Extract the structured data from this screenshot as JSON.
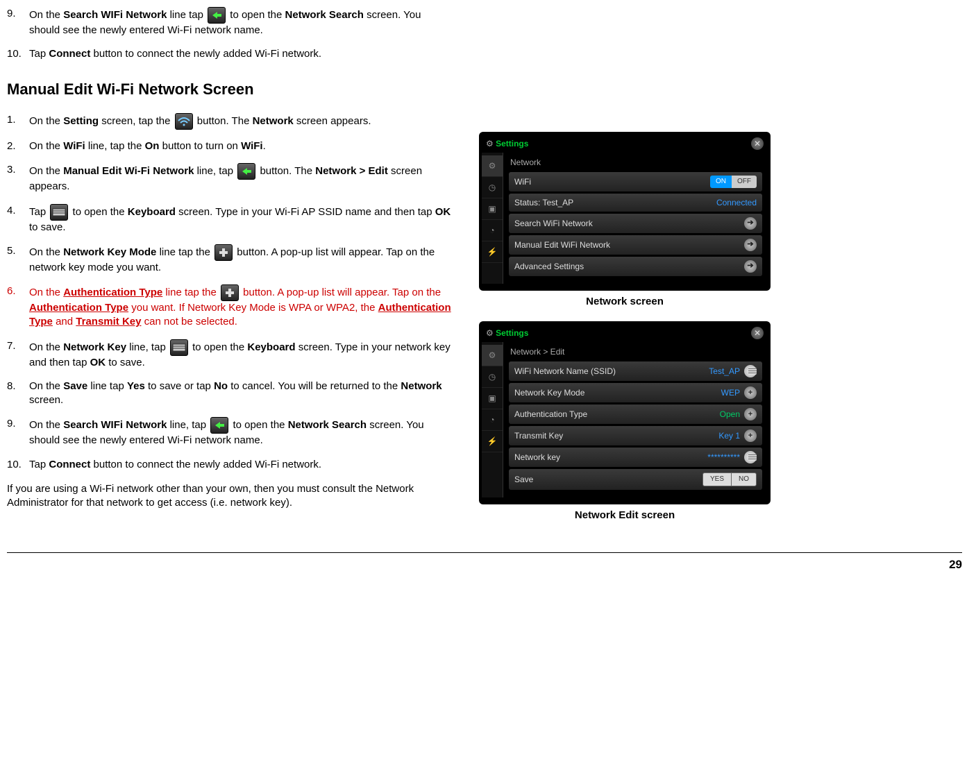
{
  "page_number": "29",
  "top_steps": [
    {
      "num": "9.",
      "parts": [
        {
          "t": "On the "
        },
        {
          "b": "Search WIFi Network"
        },
        {
          "t": " line tap "
        },
        {
          "icon": "arrow"
        },
        {
          "t": " to open the "
        },
        {
          "b": "Network Search"
        },
        {
          "t": " screen.  You should see the newly entered Wi-Fi network name."
        }
      ]
    },
    {
      "num": "10.",
      "parts": [
        {
          "t": "Tap "
        },
        {
          "b": "Connect"
        },
        {
          "t": " button to connect the newly added Wi-Fi network."
        }
      ]
    }
  ],
  "heading": "Manual Edit Wi-Fi Network Screen",
  "main_steps": [
    {
      "num": "1.",
      "parts": [
        {
          "t": "On the "
        },
        {
          "b": "Setting"
        },
        {
          "t": " screen, tap the "
        },
        {
          "icon": "wifi"
        },
        {
          "t": " button.  The "
        },
        {
          "b": "Network"
        },
        {
          "t": " screen appears."
        }
      ]
    },
    {
      "num": "2.",
      "parts": [
        {
          "t": "On the "
        },
        {
          "b": "WiFi"
        },
        {
          "t": " line, tap the "
        },
        {
          "b": "On"
        },
        {
          "t": " button to turn on "
        },
        {
          "b": "WiFi"
        },
        {
          "t": "."
        }
      ]
    },
    {
      "num": "3.",
      "parts": [
        {
          "t": "On the "
        },
        {
          "b": "Manual Edit Wi-Fi Network"
        },
        {
          "t": " line, tap "
        },
        {
          "icon": "arrow"
        },
        {
          "t": " button.  The "
        },
        {
          "b": "Network > Edit"
        },
        {
          "t": " screen appears."
        }
      ]
    },
    {
      "num": "4.",
      "parts": [
        {
          "t": "Tap "
        },
        {
          "icon": "keyboard"
        },
        {
          "t": " to open the "
        },
        {
          "b": "Keyboard"
        },
        {
          "t": " screen.  Type in your Wi-Fi AP SSID name and then tap "
        },
        {
          "b": "OK"
        },
        {
          "t": " to save."
        }
      ]
    },
    {
      "num": "5.",
      "parts": [
        {
          "t": "On the "
        },
        {
          "b": "Network Key Mode"
        },
        {
          "t": " line tap the "
        },
        {
          "icon": "plus"
        },
        {
          "t": " button.  A pop-up list will appear.  Tap on the network key mode you want."
        }
      ]
    },
    {
      "num": "6.",
      "red": true,
      "parts": [
        {
          "t": "On the "
        },
        {
          "bu": "Authentication Type"
        },
        {
          "t": " line tap the "
        },
        {
          "icon": "plus"
        },
        {
          "t": " button.  A pop-up list will appear.  Tap on the "
        },
        {
          "bu": "Authentication Type"
        },
        {
          "t": " you want. If Network Key Mode is WPA or WPA2, the "
        },
        {
          "bu": "Authentication Type"
        },
        {
          "t": " and "
        },
        {
          "bu": "Transmit Key"
        },
        {
          "t": " can not be selected."
        }
      ]
    },
    {
      "num": "7.",
      "parts": [
        {
          "t": "On the "
        },
        {
          "b": "Network Key"
        },
        {
          "t": " line, tap "
        },
        {
          "icon": "keyboard"
        },
        {
          "t": " to open the "
        },
        {
          "b": "Keyboard"
        },
        {
          "t": " screen.  Type in your network key and then tap "
        },
        {
          "b": "OK"
        },
        {
          "t": " to save."
        }
      ]
    },
    {
      "num": "8.",
      "parts": [
        {
          "t": "On the "
        },
        {
          "b": "Save"
        },
        {
          "t": " line tap "
        },
        {
          "b": "Yes"
        },
        {
          "t": " to save or tap "
        },
        {
          "b": "No"
        },
        {
          "t": " to cancel.  You will be returned to the "
        },
        {
          "b": "Network"
        },
        {
          "t": " screen."
        }
      ]
    },
    {
      "num": "9.",
      "parts": [
        {
          "t": "On the "
        },
        {
          "b": "Search WIFi Network"
        },
        {
          "t": " line, tap "
        },
        {
          "icon": "arrow"
        },
        {
          "t": " to open the "
        },
        {
          "b": "Network Search"
        },
        {
          "t": " screen.  You should see the newly entered Wi-Fi network name."
        }
      ]
    },
    {
      "num": "10.",
      "parts": [
        {
          "t": "Tap "
        },
        {
          "b": "Connect"
        },
        {
          "t": " button to connect the newly added Wi-Fi network."
        }
      ]
    }
  ],
  "footer_note": "If you are using a Wi-Fi network other than your own, then you must consult the Network Administrator for that network to get access (i.e. network key).",
  "screenshot1": {
    "title": "Settings",
    "breadcrumb": "Network",
    "caption": "Network screen",
    "rows": [
      {
        "label": "WiFi",
        "type": "onoff",
        "on": "ON",
        "off": "OFF"
      },
      {
        "label": "Status: Test_AP",
        "type": "text",
        "value": "Connected",
        "color": "blue"
      },
      {
        "label": "Search WiFi Network",
        "type": "arrow"
      },
      {
        "label": "Manual Edit WiFi Network",
        "type": "arrow"
      },
      {
        "label": "Advanced Settings",
        "type": "arrow"
      }
    ]
  },
  "screenshot2": {
    "title": "Settings",
    "breadcrumb": "Network > Edit",
    "caption": "Network Edit screen",
    "rows": [
      {
        "label": "WiFi Network Name (SSID)",
        "type": "value-key",
        "value": "Test_AP",
        "icon": "keyboard",
        "color": "blue"
      },
      {
        "label": "Network Key Mode",
        "type": "value-plus",
        "value": "WEP",
        "color": "blue"
      },
      {
        "label": "Authentication Type",
        "type": "value-plus",
        "value": "Open",
        "color": "green"
      },
      {
        "label": "Transmit Key",
        "type": "value-plus",
        "value": "Key 1",
        "color": "blue"
      },
      {
        "label": "Network key",
        "type": "value-key",
        "value": "**********",
        "color": "blue"
      },
      {
        "label": "Save",
        "type": "yesno",
        "yes": "YES",
        "no": "NO"
      }
    ]
  }
}
